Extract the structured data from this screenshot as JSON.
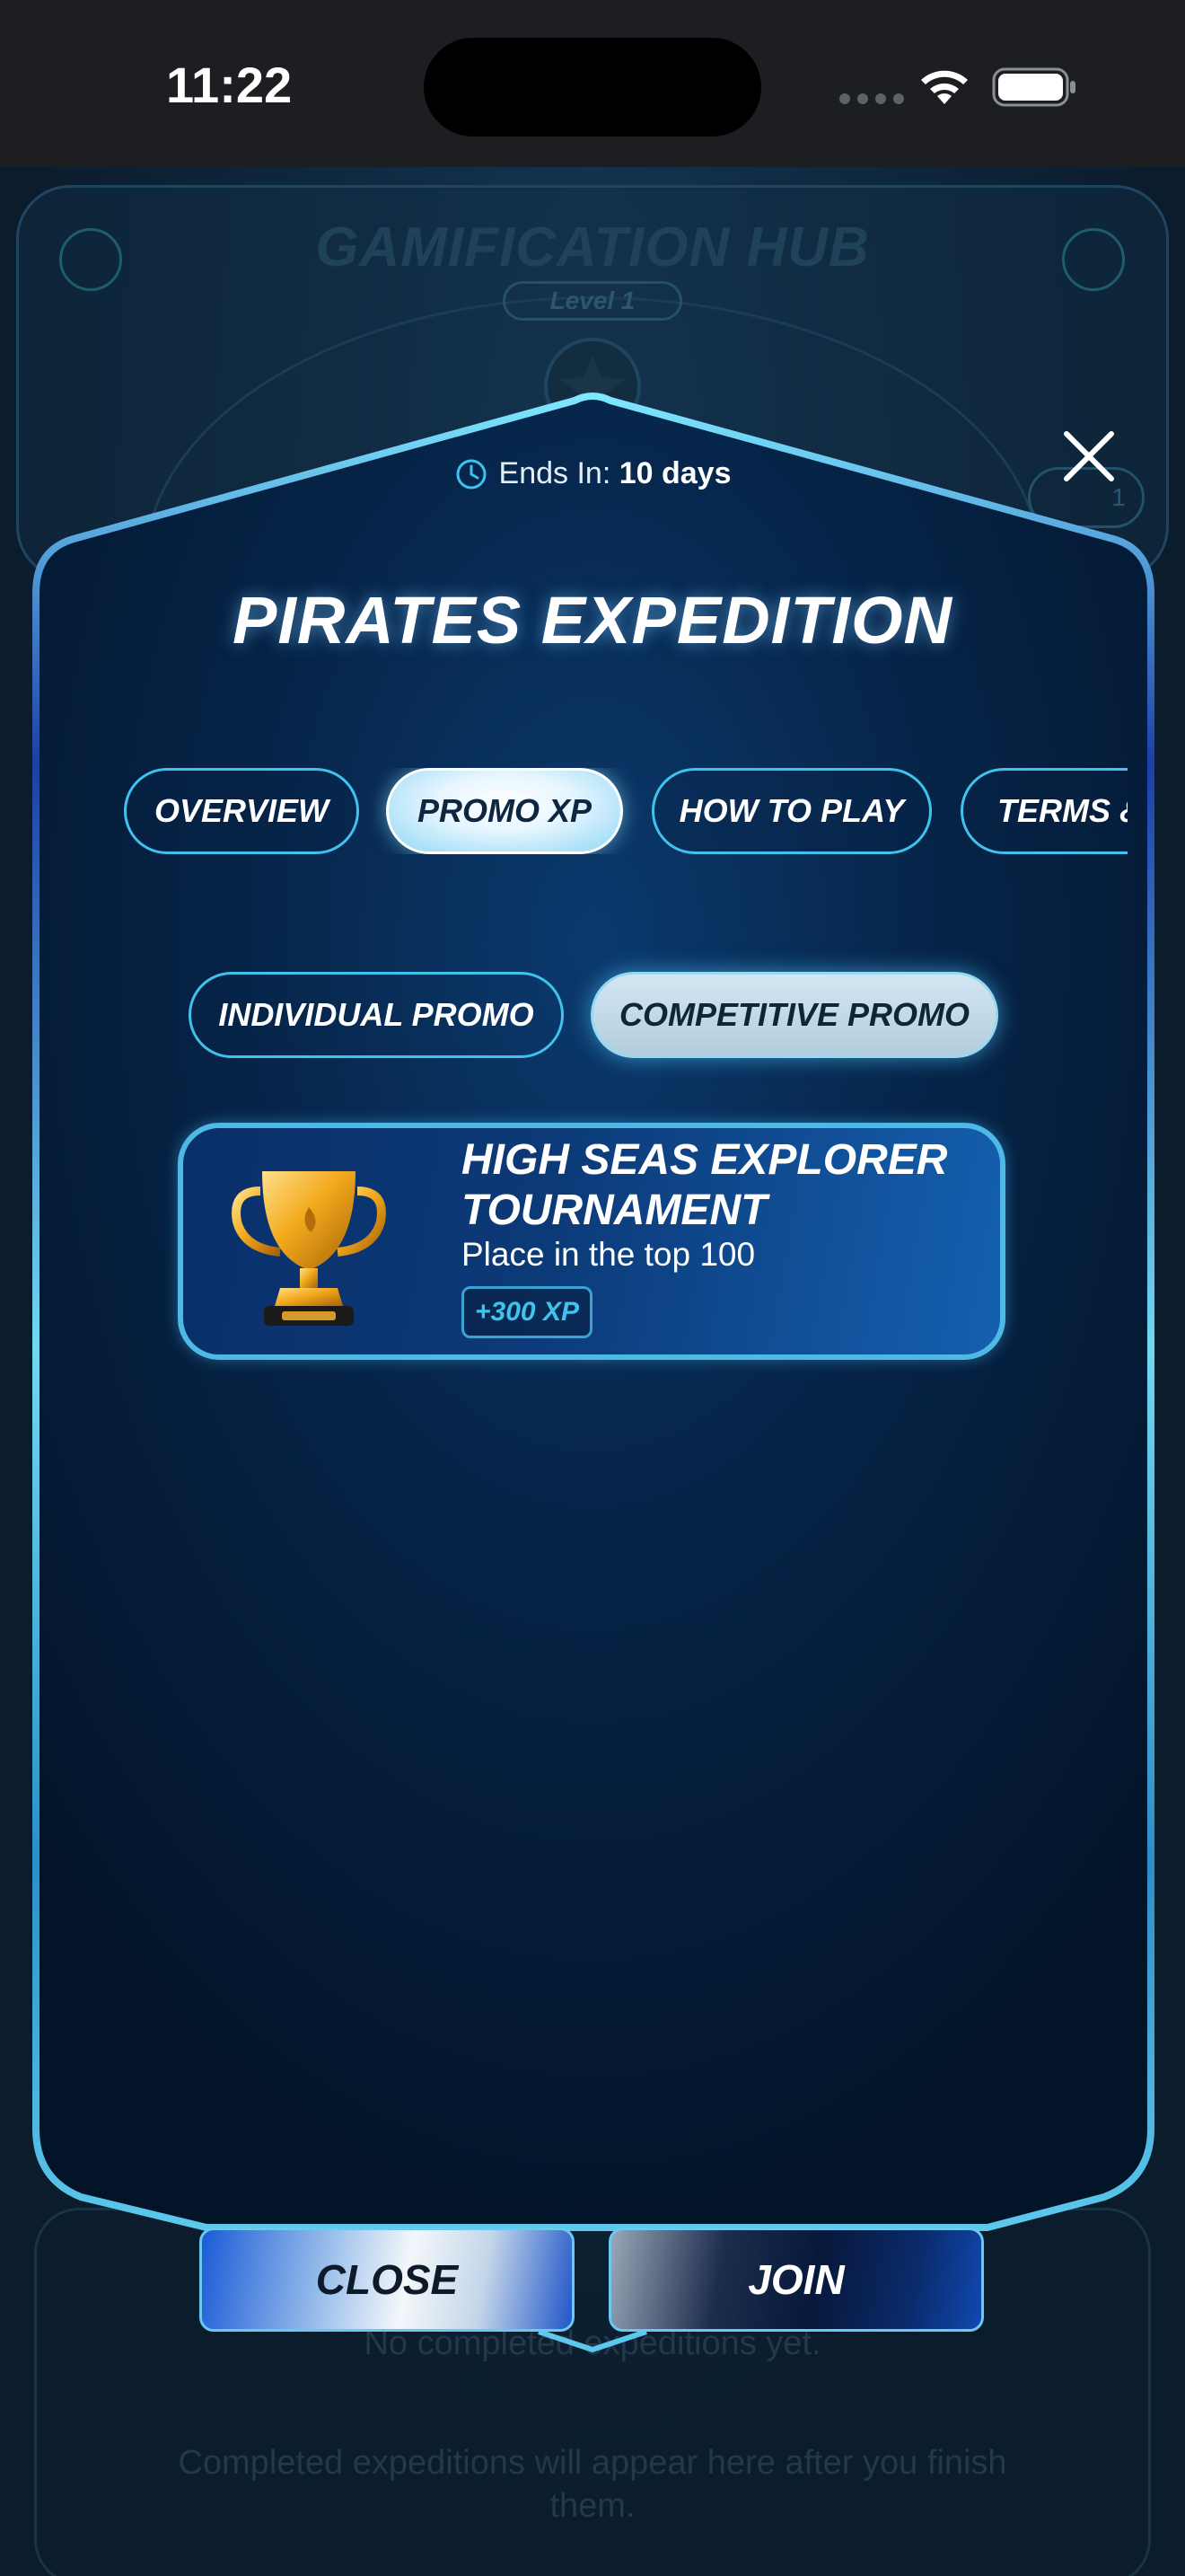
{
  "status_bar": {
    "time": "11:22",
    "signal_icon": "signal-dots-icon",
    "wifi_icon": "wifi-icon",
    "battery_icon": "battery-icon"
  },
  "background_hub": {
    "title": "GAMIFICATION HUB",
    "level": "Level 1",
    "gift_count": "1",
    "empty_title": "No completed expeditions yet.",
    "empty_subtitle": "Completed expeditions will appear here after you finish them."
  },
  "modal": {
    "ends_in_label": "Ends In:",
    "ends_in_value": "10 days",
    "title": "PIRATES EXPEDITION",
    "tabs": [
      {
        "label": "OVERVIEW",
        "active": false
      },
      {
        "label": "PROMO XP",
        "active": true
      },
      {
        "label": "HOW TO PLAY",
        "active": false
      },
      {
        "label": "TERMS & CONDITIONS",
        "active": false
      }
    ],
    "sub_tabs": [
      {
        "label": "INDIVIDUAL PROMO",
        "active": false
      },
      {
        "label": "COMPETITIVE PROMO",
        "active": true
      }
    ],
    "promo_card": {
      "title": "HIGH SEAS EXPLORER TOURNAMENT",
      "description": "Place in the top 100",
      "xp": "+300 XP",
      "image": "trophy-icon"
    },
    "buttons": {
      "close_label": "CLOSE",
      "join_label": "JOIN"
    }
  },
  "colors": {
    "accent": "#3fc2ec",
    "modal_bg": "#041a33",
    "frame_border": "#5ad3f0"
  }
}
